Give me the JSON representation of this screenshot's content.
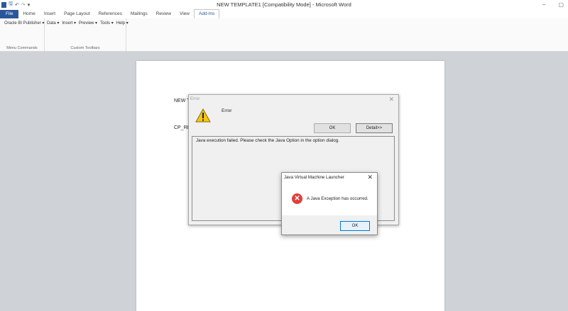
{
  "window": {
    "title": "NEW TEMPLATE1 [Compatibility Mode]  -  Microsoft Word",
    "minimize_glyph": "–",
    "restore_glyph": "▢"
  },
  "quick_access": {
    "icons": [
      "word-app-icon",
      "save-icon",
      "undo-icon",
      "redo-icon",
      "customize-icon"
    ],
    "save_glyph": "🖫",
    "undo_glyph": "↶",
    "redo_glyph": "↷",
    "dropdown_glyph": "▾"
  },
  "tabs": [
    "File",
    "Home",
    "Insert",
    "Page Layout",
    "References",
    "Mailings",
    "Review",
    "View",
    "Add-Ins"
  ],
  "active_tab": "Add-Ins",
  "ribbon": {
    "group1": {
      "menu": "Oracle BI Publisher ▾",
      "label": "Menu Commands"
    },
    "group2": {
      "menus": [
        "Data ▾",
        "Insert ▾",
        "Preview ▾",
        "Tools ▾",
        "Help ▾"
      ],
      "label": "Custom Toolbars"
    }
  },
  "document": {
    "line1": "NEW T",
    "line2": "CP_RE"
  },
  "error_dialog": {
    "title": "Error",
    "close_glyph": "✕",
    "message": "Error",
    "ok_label": "OK",
    "detail_label": "Detail>>",
    "detail_text": "Java execution failed.  Please check the Java Option in the option dialog.",
    "icon": "warning-icon"
  },
  "jvm_dialog": {
    "title": "Java Virtual Machine Launcher",
    "close_glyph": "✕",
    "message": "A Java Exception has occurred.",
    "ok_label": "OK",
    "icon": "error-icon",
    "icon_glyph": "✕",
    "icon_color": "#e0403a"
  },
  "colors": {
    "file_tab": "#2b579a",
    "accent": "#2b579a"
  }
}
